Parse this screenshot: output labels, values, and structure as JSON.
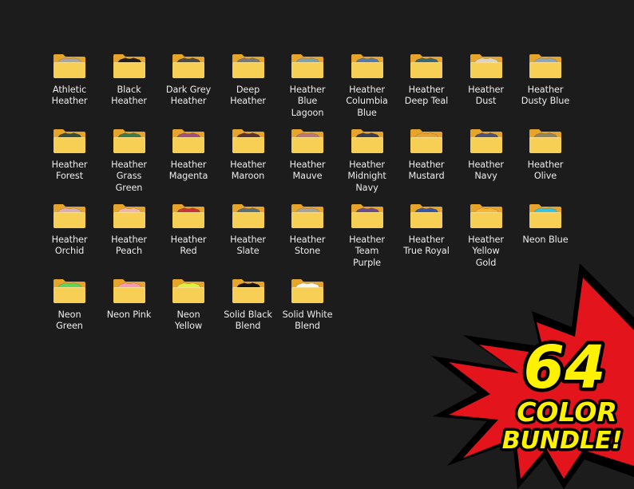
{
  "folders": [
    {
      "label": "Athletic\nHeather",
      "color": "#a7a8a6"
    },
    {
      "label": "Black\nHeather",
      "color": "#1f1f1f"
    },
    {
      "label": "Dark Grey\nHeather",
      "color": "#4a4a48"
    },
    {
      "label": "Deep\nHeather",
      "color": "#77787a"
    },
    {
      "label": "Heather\nBlue\nLagoon",
      "color": "#7fa1ad"
    },
    {
      "label": "Heather\nColumbia\nBlue",
      "color": "#5978ab"
    },
    {
      "label": "Heather\nDeep Teal",
      "color": "#3c6670"
    },
    {
      "label": "Heather\nDust",
      "color": "#dcd3c7"
    },
    {
      "label": "Heather\nDusty Blue",
      "color": "#8ea6bf"
    },
    {
      "label": "Heather\nForest",
      "color": "#354e3e"
    },
    {
      "label": "Heather\nGrass\nGreen",
      "color": "#3d7c4a"
    },
    {
      "label": "Heather\nMagenta",
      "color": "#a0517d"
    },
    {
      "label": "Heather\nMaroon",
      "color": "#5a3335"
    },
    {
      "label": "Heather\nMauve",
      "color": "#b8777b"
    },
    {
      "label": "Heather\nMidnight\nNavy",
      "color": "#383d4f"
    },
    {
      "label": "Heather\nMustard",
      "color": "#e3a43a"
    },
    {
      "label": "Heather\nNavy",
      "color": "#4c5278"
    },
    {
      "label": "Heather\nOlive",
      "color": "#8d8563"
    },
    {
      "label": "Heather\nOrchid",
      "color": "#d9aeb5"
    },
    {
      "label": "Heather\nPeach",
      "color": "#efb7a7"
    },
    {
      "label": "Heather\nRed",
      "color": "#c7353b"
    },
    {
      "label": "Heather\nSlate",
      "color": "#5f6d75"
    },
    {
      "label": "Heather\nStone",
      "color": "#a6a39c"
    },
    {
      "label": "Heather\nTeam\nPurple",
      "color": "#6a4e8a"
    },
    {
      "label": "Heather\nTrue Royal",
      "color": "#3b55a5"
    },
    {
      "label": "Heather\nYellow\nGold",
      "color": "#f3b637"
    },
    {
      "label": "Neon Blue",
      "color": "#39c2dc"
    },
    {
      "label": "Neon\nGreen",
      "color": "#5fd45e"
    },
    {
      "label": "Neon Pink",
      "color": "#f59ab8"
    },
    {
      "label": "Neon\nYellow",
      "color": "#d8f23d"
    },
    {
      "label": "Solid Black\nBlend",
      "color": "#151515"
    },
    {
      "label": "Solid White\nBlend",
      "color": "#f6f6f6"
    }
  ],
  "burst": {
    "line1": "64",
    "line2": "COLOR",
    "line3": "BUNDLE!",
    "text_color": "#fff200",
    "fill_color": "#e3141b",
    "outline_color": "#000000"
  },
  "colors": {
    "background": "#1c1c1c",
    "folder_back": "#e6a52a",
    "folder_front": "#f7cf55",
    "label_text": "#ececec"
  }
}
